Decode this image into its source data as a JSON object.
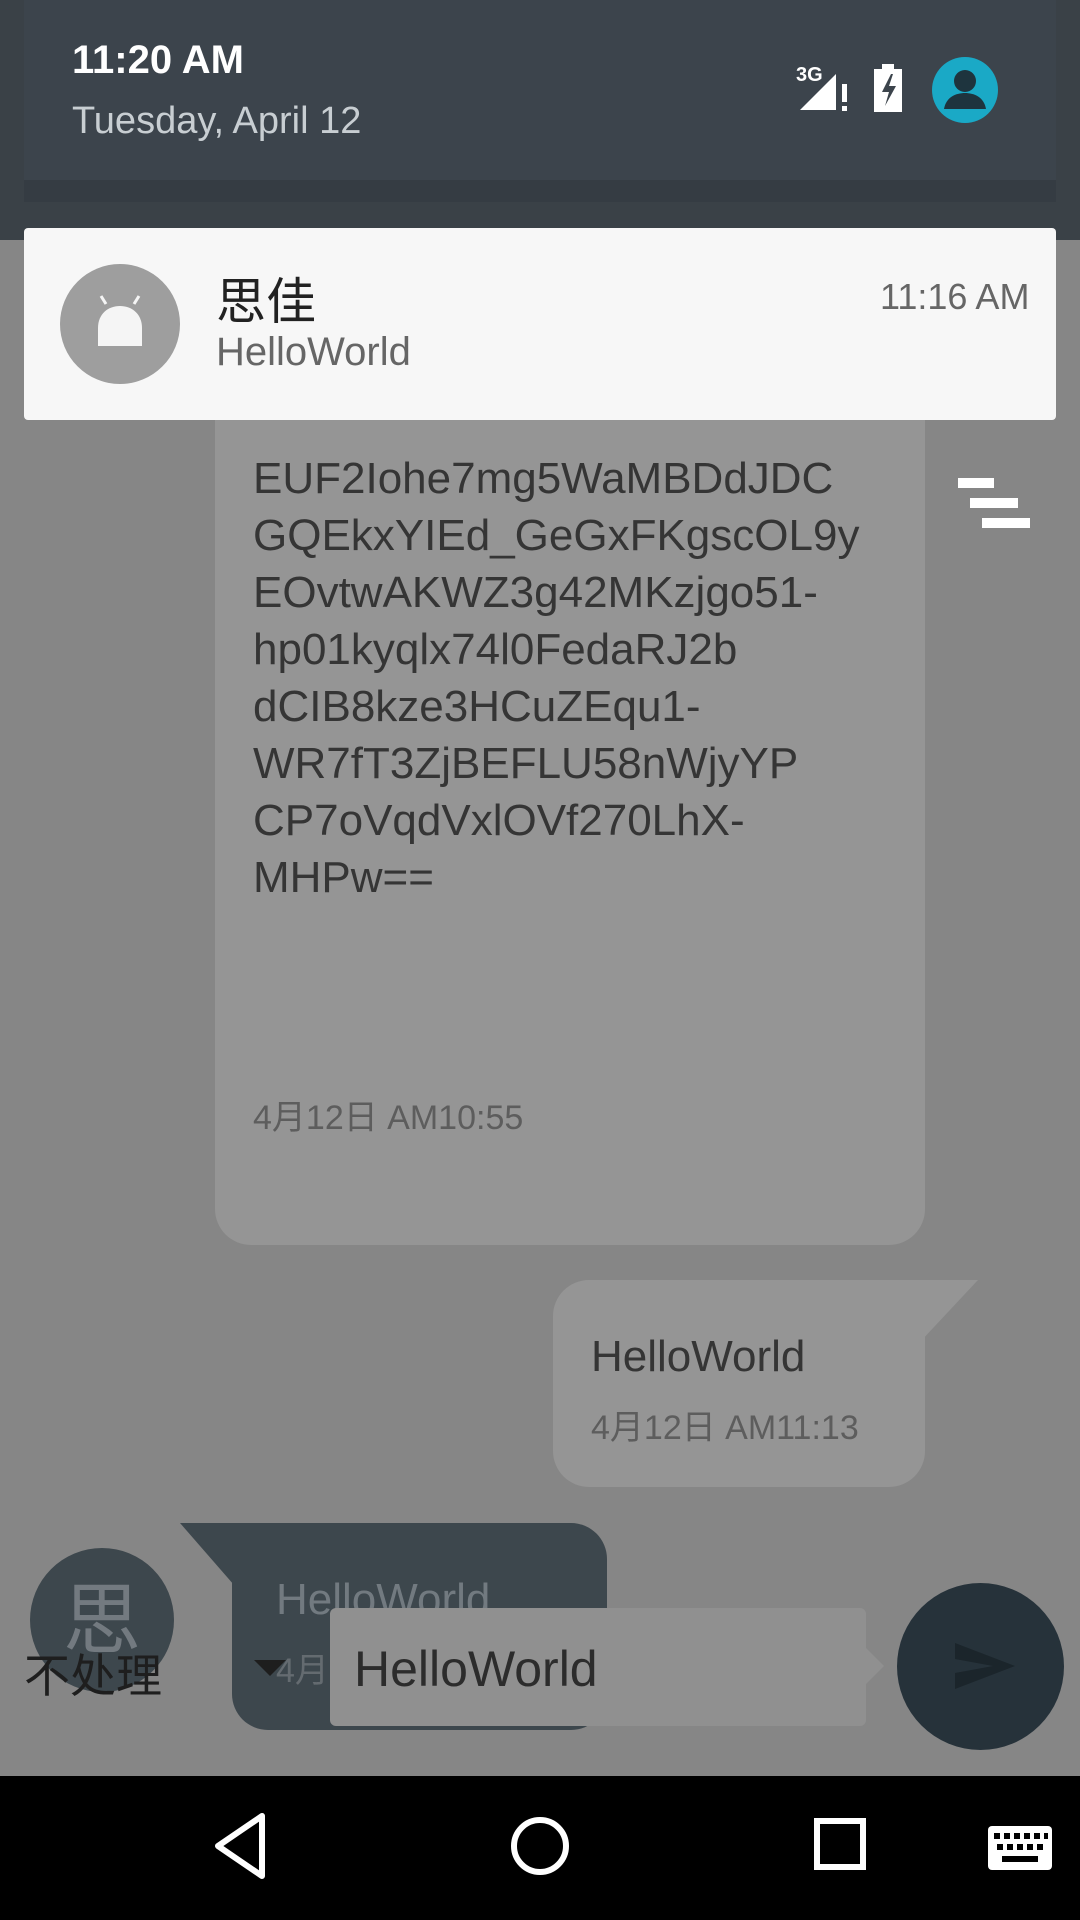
{
  "status_shade": {
    "time": "11:20 AM",
    "date": "Tuesday, April 12",
    "network_label": "3G",
    "icons": [
      "network-3g-icon",
      "battery-charging-icon",
      "user-account-icon"
    ]
  },
  "notification": {
    "sender": "思佳",
    "message": "HelloWorld",
    "time": "11:16 AM",
    "icon": "android-app-icon"
  },
  "conversation": {
    "messages": [
      {
        "direction": "incoming",
        "text": "EUF2Iohe7mg5WaMBDdJDC\nGQEkxYIEd_GeGxFKgscOL9y\nEOvtwAKWZ3g42MKzjgo51-\nhp01kyqlx74l0FedaRJ2b\ndCIB8kze3HCuZEqu1-\nWR7fT3ZjBEFLU58nWjyYP\nCP7oVqdVxlOVf270LhX-\nMHPw==",
        "time": "4月12日 AM10:55"
      },
      {
        "direction": "outgoing",
        "text": "HelloWorld",
        "time": "4月12日 AM11:13"
      },
      {
        "direction": "incoming",
        "avatar_char": "思",
        "text": "HelloWorld",
        "time": "4月12日 AM11:16"
      }
    ]
  },
  "composer": {
    "mode_selected": "不处理",
    "input_value": "HelloWorld",
    "send_icon": "send-icon"
  },
  "navbar": {
    "icons": [
      "back-icon",
      "home-icon",
      "recents-icon",
      "keyboard-icon"
    ]
  }
}
